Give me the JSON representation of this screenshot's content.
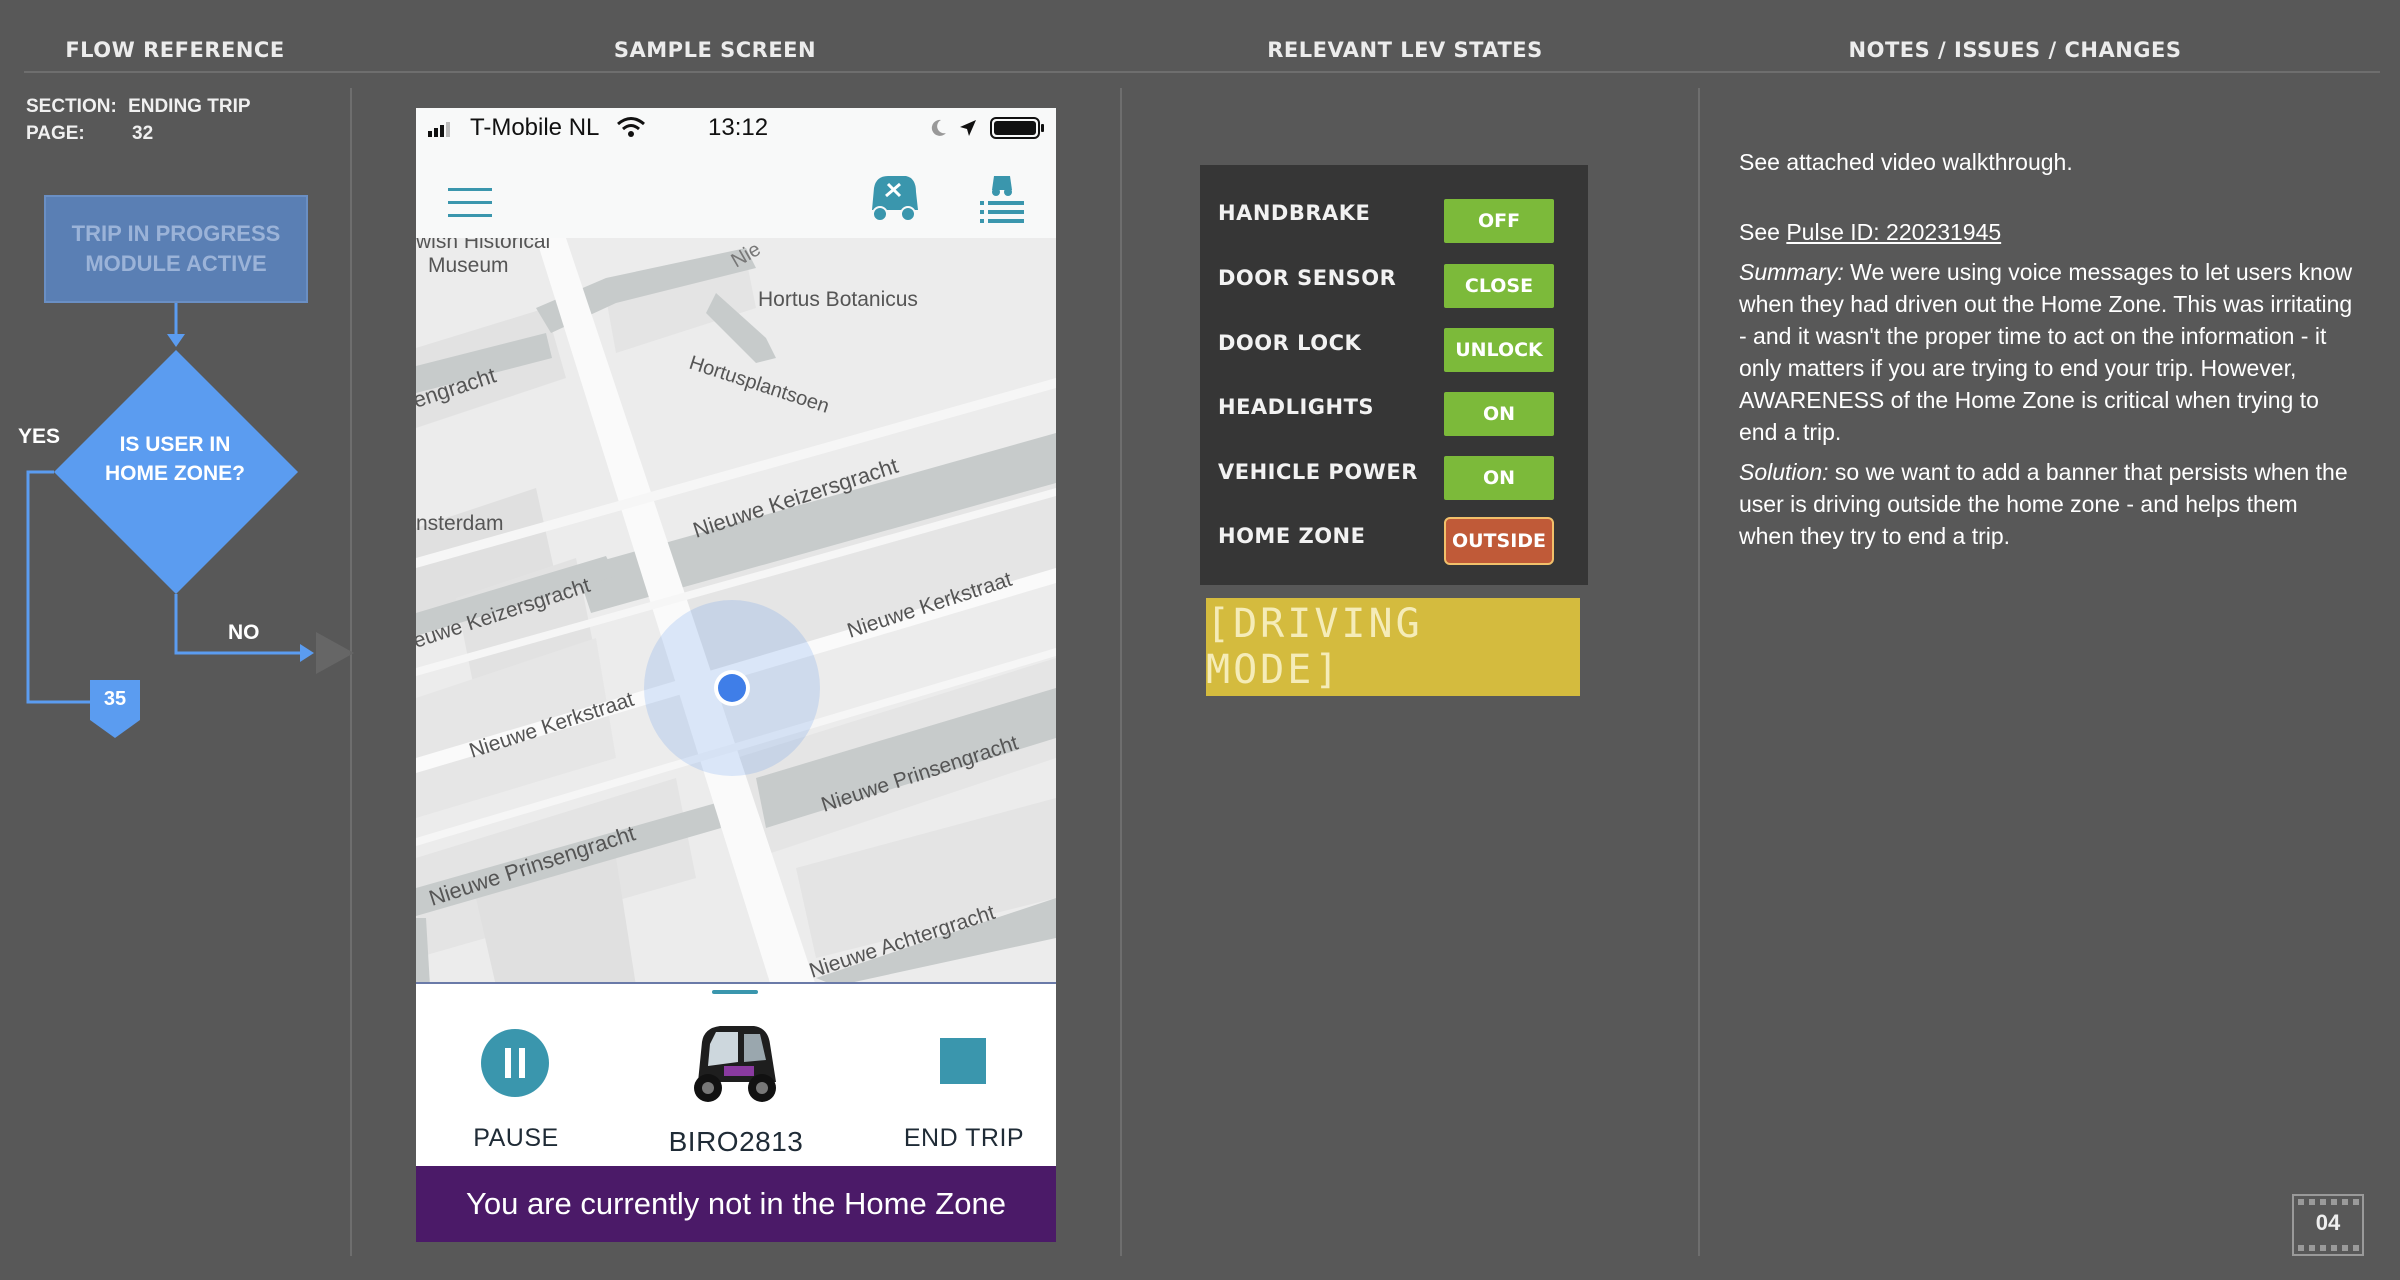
{
  "headers": {
    "flow": "FLOW REFERENCE",
    "sample": "SAMPLE SCREEN",
    "states": "RELEVANT LEV STATES",
    "notes": "NOTES / ISSUES / CHANGES"
  },
  "flow": {
    "section_label": "SECTION:",
    "section_value": "ENDING TRIP",
    "page_label": "PAGE:",
    "page_value": "32",
    "trip_box_line1": "TRIP IN PROGRESS",
    "trip_box_line2": "MODULE ACTIVE",
    "decision_line1": "IS USER IN",
    "decision_line2": "HOME ZONE?",
    "yes": "YES",
    "no": "NO",
    "yes_target_page": "35"
  },
  "phone": {
    "carrier": "T-Mobile NL",
    "time": "13:12",
    "map_labels": {
      "museum1": "wish Historical",
      "museum2": "Museum",
      "hortus": "Hortus Botanicus",
      "hortusplant": "Hortusplantsoen",
      "gracht_left": "engracht",
      "amsterdam": "nsterdam",
      "keizers1": "Nieuwe Keizersgracht",
      "keizers2": "euwe Keizersgracht",
      "kerk1": "Nieuwe Kerkstraat",
      "kerk2": "Nieuwe Kerkstraat",
      "prinsen1": "Nieuwe Prinsengracht",
      "prinsen2": "Nieuwe Prinsengracht",
      "achter": "Nieuwe Achtergracht",
      "top_partial": "Nie"
    },
    "controls": {
      "pause": "PAUSE",
      "vehicle": "BIRO2813",
      "end_trip": "END TRIP"
    },
    "banner": "You are currently not in the Home Zone"
  },
  "states": [
    {
      "label": "HANDBRAKE",
      "value": "OFF",
      "color": "#7cba3a"
    },
    {
      "label": "DOOR SENSOR",
      "value": "CLOSE",
      "color": "#7cba3a"
    },
    {
      "label": "DOOR LOCK",
      "value": "UNLOCK",
      "color": "#7cba3a"
    },
    {
      "label": "HEADLIGHTS",
      "value": "ON",
      "color": "#7cba3a"
    },
    {
      "label": "VEHICLE POWER",
      "value": "ON",
      "color": "#7cba3a"
    },
    {
      "label": "HOME ZONE",
      "value": "OUTSIDE",
      "color": "#c05a38"
    }
  ],
  "driving_mode": "[DRIVING MODE]",
  "notes": {
    "line1": "See attached video walkthrough.",
    "see_prefix": "See ",
    "pulse_link": "Pulse ID: 220231945",
    "summary_label": "Summary:",
    "summary_text": "  We were using voice messages to let users know when they had driven out the Home Zone. This was irritating - and it wasn't the proper time to act on the information - it only matters if you are trying to end your trip.  However, AWARENESS of the Home Zone is critical when trying to end a trip.",
    "solution_label": "Solution:",
    "solution_text": "  so we want to add a banner that persists when the user is driving outside the home zone - and helps them when they try to end a trip."
  },
  "slide_number": "04"
}
